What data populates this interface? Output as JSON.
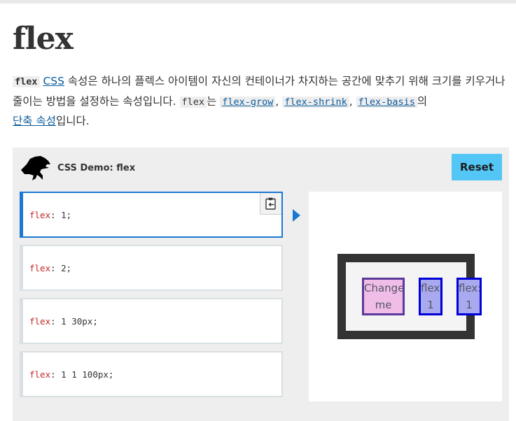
{
  "page": {
    "title": "flex"
  },
  "intro": {
    "code_flex": "flex",
    "css_link": "CSS",
    "text1": "속성은 하나의 플렉스 아이템이 자신의 컨테이너가 차지하는 공간에 맞추기 위해 크기를 키우거나 줄이는 방법을 설정하는 속성입니다.",
    "code_flex2": "flex",
    "text2": "는",
    "link_grow": "flex-grow",
    "comma1": ",",
    "link_shrink": "flex-shrink",
    "comma2": ",",
    "link_basis": "flex-basis",
    "text3": "의",
    "link_shorthand": "단축 속성",
    "text4": "입니다."
  },
  "demo": {
    "title": "CSS Demo: flex",
    "reset_label": "Reset",
    "choices": [
      {
        "prop": "flex",
        "value": ": 1;",
        "selected": true
      },
      {
        "prop": "flex",
        "value": ": 2;",
        "selected": false
      },
      {
        "prop": "flex",
        "value": ": 1 30px;",
        "selected": false
      },
      {
        "prop": "flex",
        "value": ": 1 1 100px;",
        "selected": false
      }
    ],
    "output": {
      "item1_line1": "Change",
      "item1_line2": "me",
      "item2_line1": "flex:",
      "item2_line2": "1",
      "item3_line1": "flex:",
      "item3_line2": "1"
    }
  },
  "colors": {
    "accent": "#1a78d2",
    "reset_button": "#53c6f5",
    "code_property": "#c62828",
    "link": "#0a5b9c"
  },
  "icons": {
    "logo": "dinosaur-logo-icon",
    "copy": "clipboard-copy-icon",
    "selected_arrow": "play-arrow-icon"
  }
}
